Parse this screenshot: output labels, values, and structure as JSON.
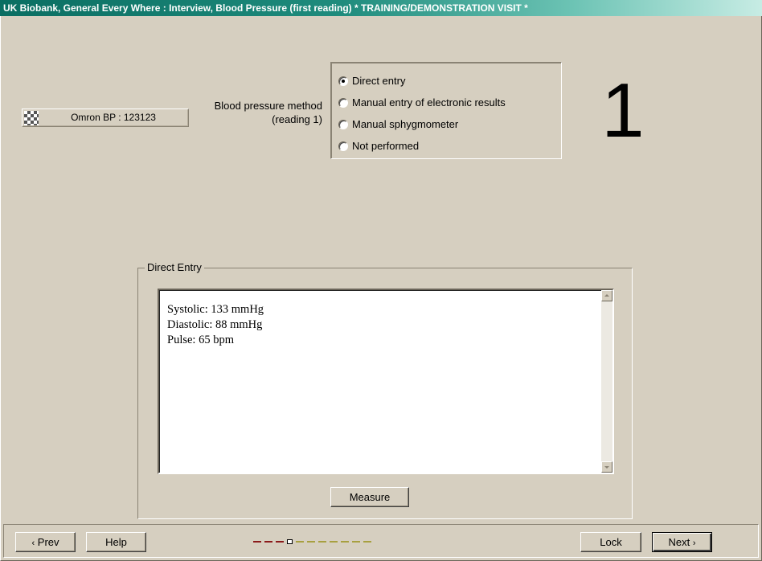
{
  "window": {
    "title": "UK Biobank, General Every Where : Interview, Blood Pressure (first reading) * TRAINING/DEMONSTRATION VISIT *"
  },
  "device": {
    "label": "Omron BP : 123123"
  },
  "method": {
    "label_line1": "Blood pressure method",
    "label_line2": "(reading 1)",
    "options": [
      {
        "label": "Direct entry",
        "selected": true
      },
      {
        "label": "Manual entry of electronic results",
        "selected": false
      },
      {
        "label": "Manual sphygmometer",
        "selected": false
      },
      {
        "label": "Not performed",
        "selected": false
      }
    ]
  },
  "reading_number": "1",
  "direct_entry": {
    "legend": "Direct Entry",
    "lines": [
      "Systolic: 133 mmHg",
      "Diastolic: 88 mmHg",
      "Pulse: 65 bpm"
    ],
    "measure_label": "Measure"
  },
  "nav": {
    "prev_label": "Prev",
    "help_label": "Help",
    "lock_label": "Lock",
    "next_label": "Next",
    "progress": {
      "completed": 3,
      "current": 4,
      "total": 11
    }
  },
  "colors": {
    "titlebar_start": "#0a6e62",
    "background": "#d6cfc0",
    "progress_done": "#8b1a1a",
    "progress_todo": "#a8a040"
  }
}
